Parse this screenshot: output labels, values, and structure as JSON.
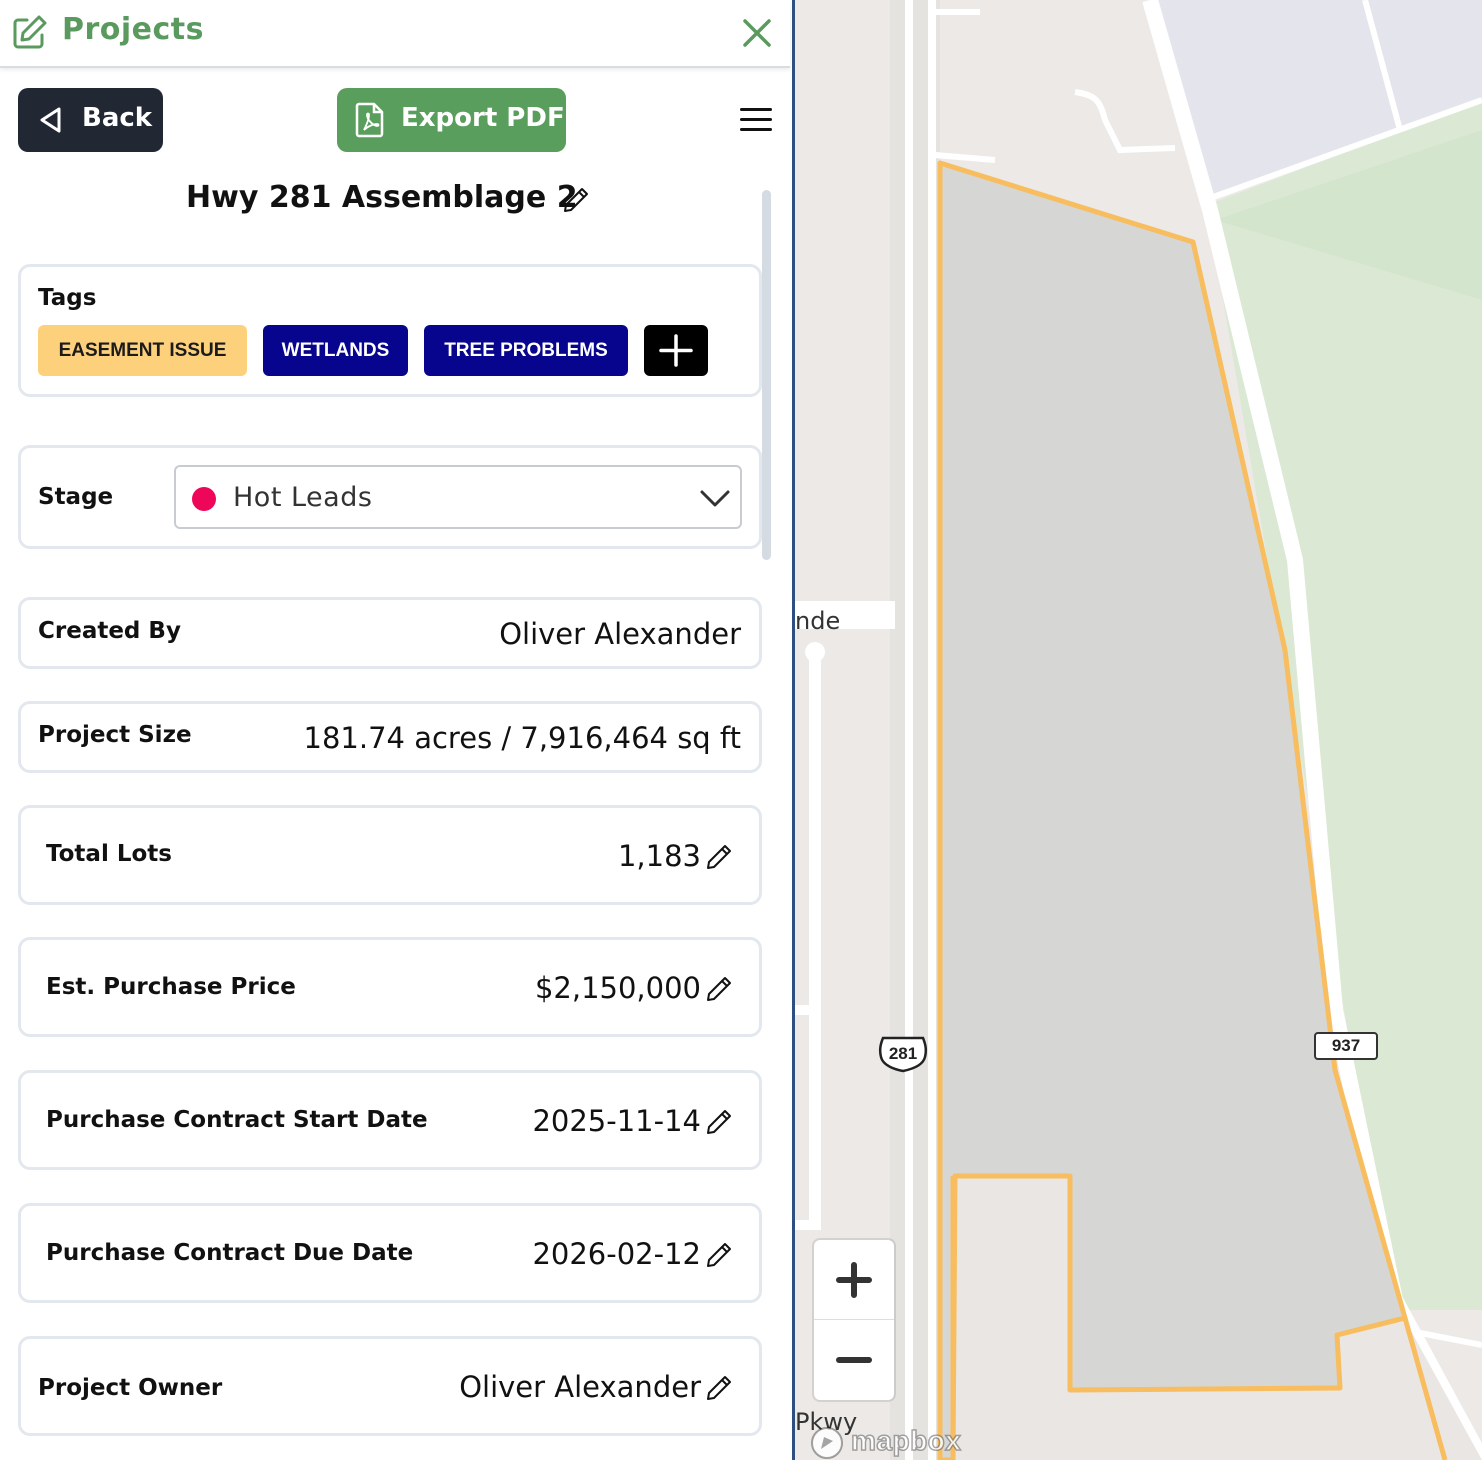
{
  "header": {
    "title": "Projects"
  },
  "toolbar": {
    "back_label": "Back",
    "export_label": "Export PDF"
  },
  "project": {
    "name": "Hwy 281 Assemblage 2"
  },
  "tags": {
    "label": "Tags",
    "items": [
      {
        "label": "EASEMENT ISSUE",
        "bg": "#fdd17c",
        "fg": "#1b1b1b"
      },
      {
        "label": "WETLANDS",
        "bg": "#07058d",
        "fg": "#ffffff"
      },
      {
        "label": "TREE PROBLEMS",
        "bg": "#07058d",
        "fg": "#ffffff"
      }
    ]
  },
  "stage": {
    "label": "Stage",
    "value": "Hot Leads",
    "dot_color": "#ee0659"
  },
  "fields": {
    "created_by": {
      "label": "Created By",
      "value": "Oliver Alexander"
    },
    "project_size": {
      "label": "Project Size",
      "value": "181.74 acres / 7,916,464 sq ft"
    },
    "total_lots": {
      "label": "Total Lots",
      "value": "1,183"
    },
    "purchase_price": {
      "label": "Est. Purchase Price",
      "value": "$2,150,000"
    },
    "contract_start": {
      "label": "Purchase Contract Start Date",
      "value": "2025-11-14"
    },
    "contract_due": {
      "label": "Purchase Contract Due Date",
      "value": "2026-02-12"
    },
    "project_owner": {
      "label": "Project Owner",
      "value": "Oliver Alexander"
    }
  },
  "map": {
    "road_label_1": "nde",
    "road_label_2": "Pkwy",
    "shield_281": "281",
    "shield_937": "937",
    "attribution": "mapbox",
    "parcel_outline_color": "#f7bd5f",
    "parcel_fill_color": "#d6d6d5"
  },
  "colors": {
    "accent_green": "#5a9a5e",
    "dark_button": "#212833",
    "divider": "#2d4f82"
  }
}
